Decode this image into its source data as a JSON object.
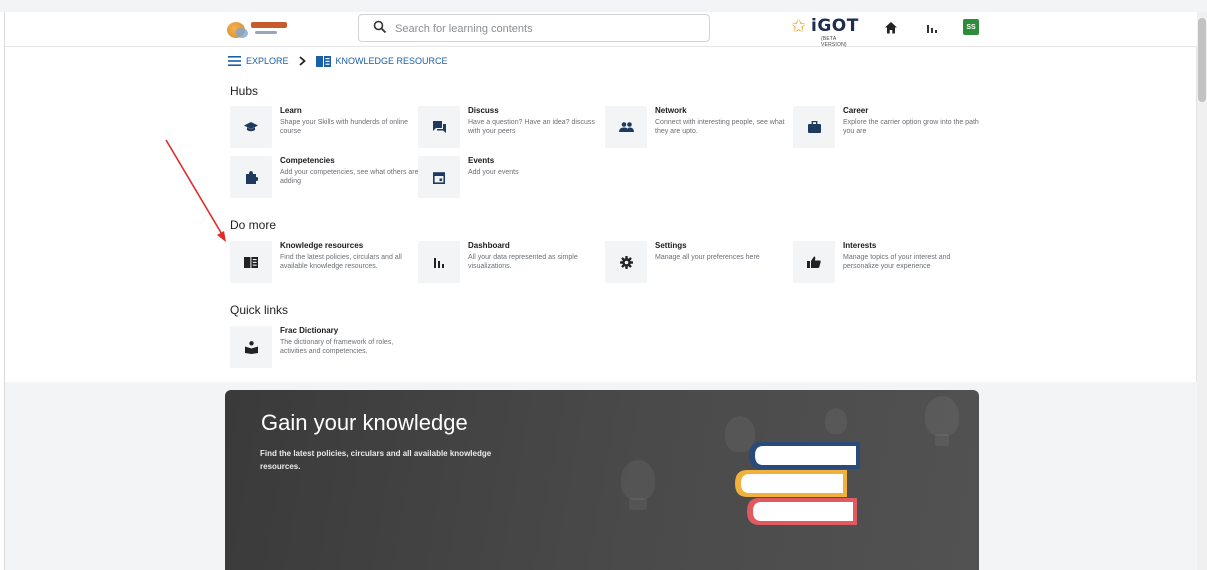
{
  "header": {
    "search_placeholder": "Search for learning contents",
    "brand": "iGOT",
    "brand_sub": "(BETA VERSION)",
    "avatar_initials": "SS"
  },
  "breadcrumb": {
    "explore": "EXPLORE",
    "current": "KNOWLEDGE RESOURCE"
  },
  "sections": {
    "hubs": "Hubs",
    "do_more": "Do more",
    "quick_links": "Quick links"
  },
  "hubs": [
    {
      "title": "Learn",
      "desc": "Shape your Skills with hunderds of online course",
      "icon": "graduation-cap-icon"
    },
    {
      "title": "Discuss",
      "desc": "Have a question? Have an idea? discuss with your peers",
      "icon": "forum-icon"
    },
    {
      "title": "Network",
      "desc": "Connect with interesting people, see what they are upto.",
      "icon": "people-icon"
    },
    {
      "title": "Career",
      "desc": "Explore the carrier option grow into the path you are",
      "icon": "briefcase-icon"
    },
    {
      "title": "Competencies",
      "desc": "Add your competencies, see what others are adding",
      "icon": "puzzle-icon"
    },
    {
      "title": "Events",
      "desc": "Add your events",
      "icon": "calendar-icon"
    }
  ],
  "do_more": [
    {
      "title": "Knowledge resources",
      "desc": "Find the latest policies, circulars and all available knowledge resources.",
      "icon": "book-icon"
    },
    {
      "title": "Dashboard",
      "desc": "All your data represented as simple visualizations.",
      "icon": "bar-chart-icon"
    },
    {
      "title": "Settings",
      "desc": "Manage all your preferences here",
      "icon": "gear-icon"
    },
    {
      "title": "Interests",
      "desc": "Manage topics of your interest and personalize your experience",
      "icon": "thumbs-up-icon"
    }
  ],
  "quick_links": [
    {
      "title": "Frac Dictionary",
      "desc": "The dictionary of framework of roles, activities and competencies.",
      "icon": "dictionary-icon"
    }
  ],
  "banner": {
    "heading": "Gain your knowledge",
    "sub": "Find the latest policies, circulars and all available knowledge resources."
  },
  "colors": {
    "link": "#1b5fa6",
    "banner_bg": "#3f3f3f",
    "annotation_arrow": "#e02b2b"
  }
}
